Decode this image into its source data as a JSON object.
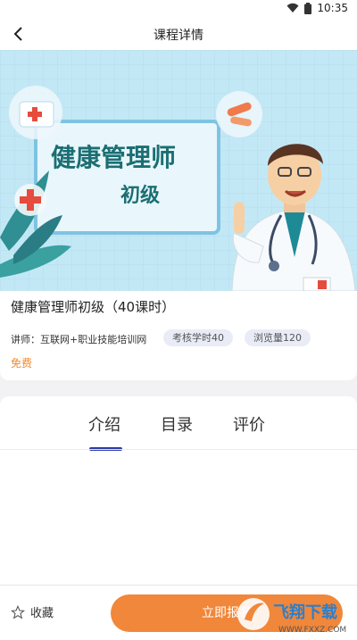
{
  "status": {
    "time": "10:35"
  },
  "nav": {
    "title": "课程详情"
  },
  "banner": {
    "line1": "健康管理师",
    "line2": "初级"
  },
  "course": {
    "title": "健康管理师初级（40课时）",
    "teacher": "讲师：互联网+职业技能培训网",
    "tags": [
      "考核学时40",
      "浏览量120"
    ],
    "price": "免费"
  },
  "tabs": [
    "介绍",
    "目录",
    "评价"
  ],
  "bottom": {
    "favorite": "收藏",
    "enroll": "立即报名"
  },
  "watermark": {
    "main": "飞翔下载",
    "url": "WWW.FXXZ.COM"
  },
  "colors": {
    "accent": "#f0873a",
    "tab_underline": "#2a3aa8",
    "price": "#f08a2c"
  }
}
